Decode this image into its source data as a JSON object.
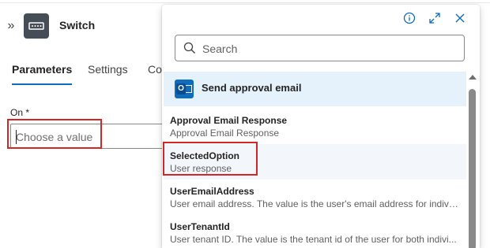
{
  "action": {
    "title": "Switch",
    "icon": "switch-action-icon"
  },
  "tabs": [
    {
      "label": "Parameters",
      "active": true
    },
    {
      "label": "Settings",
      "active": false
    },
    {
      "label": "Co",
      "active": false
    }
  ],
  "field": {
    "label": "On *",
    "placeholder": "Choose a value"
  },
  "dropdown": {
    "header_icons": [
      "info-icon",
      "expand-icon",
      "close-icon"
    ],
    "search_placeholder": "Search",
    "group": {
      "title": "Send approval email",
      "icon": "outlook-icon"
    },
    "items": [
      {
        "title": "Approval Email Response",
        "desc": "Approval Email Response"
      },
      {
        "title": "SelectedOption",
        "desc": "User response"
      },
      {
        "title": "UserEmailAddress",
        "desc": "User email address. The value is the user's email address for individ..."
      },
      {
        "title": "UserTenantId",
        "desc": "User tenant ID. The value is the tenant id of the user for both indivi..."
      }
    ]
  },
  "colors": {
    "accent": "#0f6cbd",
    "highlight_box": "#d32626",
    "group_bg": "#e5f1fb"
  }
}
